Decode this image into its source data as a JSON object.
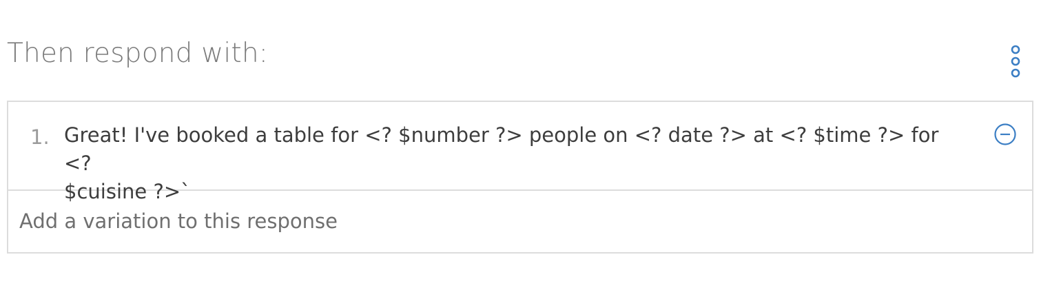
{
  "section": {
    "title": "Then respond with:",
    "menu_icon": "overflow-menu-vertical-icon"
  },
  "responses": [
    {
      "number": "1.",
      "text": "Great! I've booked a table for <? $number ?> people on <? date ?> at <? $time ?> for <?\n$cuisine ?>`",
      "remove_icon": "subtract-circle-icon"
    }
  ],
  "variation_input": {
    "placeholder": "Add a variation to this response",
    "value": ""
  },
  "colors": {
    "accent": "#3b7ec4",
    "border": "#dcdcdc",
    "title_text": "#7a7a7a",
    "body_text": "#3d3d3d"
  }
}
